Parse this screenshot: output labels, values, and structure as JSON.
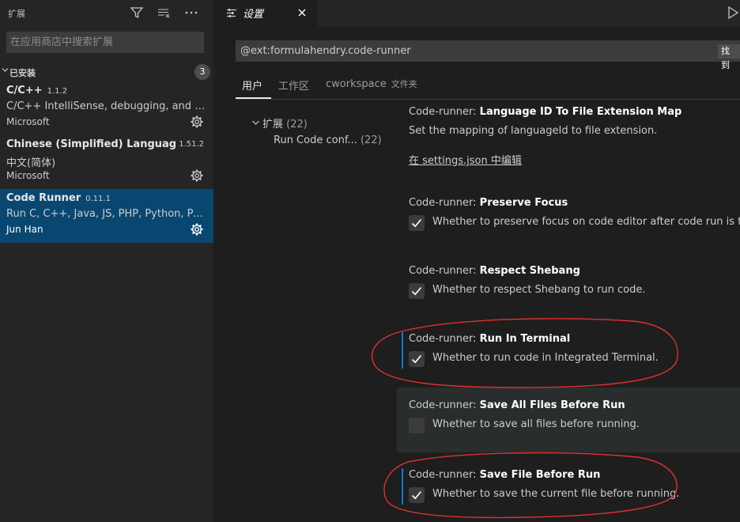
{
  "sidebar": {
    "title": "扩展",
    "search_placeholder": "在应用商店中搜索扩展",
    "section_label": "已安装",
    "installed_count": "3",
    "extensions": [
      {
        "name": "C/C++",
        "version": "1.1.2",
        "description": "C/C++ IntelliSense, debugging, and c...",
        "publisher": "Microsoft",
        "selected": false
      },
      {
        "name": "Chinese (Simplified) Languag...",
        "version": "1.51.2",
        "description": "中文(简体)",
        "publisher": "Microsoft",
        "selected": false
      },
      {
        "name": "Code Runner",
        "version": "0.11.1",
        "description": "Run C, C++, Java, JS, PHP, Python, Perl...",
        "publisher": "Jun Han",
        "selected": true
      }
    ]
  },
  "editor": {
    "tab_label": "设置"
  },
  "settings": {
    "search_value": "@ext:formulahendry.code-runner",
    "search_result_label": "找到",
    "scopes": [
      {
        "label": "用户",
        "active": true
      },
      {
        "label": "工作区",
        "active": false
      },
      {
        "label": "cworkspace",
        "sub": "文件夹",
        "active": false
      }
    ],
    "toc": [
      {
        "label": "扩展",
        "count": "(22)",
        "expanded": true
      },
      {
        "label": "Run Code conf...",
        "count": "(22)"
      }
    ],
    "items": [
      {
        "category": "Code-runner: ",
        "name": "Language ID To File Extension Map",
        "description": "Set the mapping of languageId to file extension.",
        "link": "在 settings.json 中编辑"
      },
      {
        "category": "Code-runner: ",
        "name": "Preserve Focus",
        "description": "Whether to preserve focus on code editor after code run is triggered.",
        "checked": true
      },
      {
        "category": "Code-runner: ",
        "name": "Respect Shebang",
        "description": "Whether to respect Shebang to run code.",
        "checked": true
      },
      {
        "category": "Code-runner: ",
        "name": "Run In Terminal",
        "description": "Whether to run code in Integrated Terminal.",
        "checked": true,
        "focused": true
      },
      {
        "category": "Code-runner: ",
        "name": "Save All Files Before Run",
        "description": "Whether to save all files before running.",
        "checked": false,
        "hover": true
      },
      {
        "category": "Code-runner: ",
        "name": "Save File Before Run",
        "description": "Whether to save the current file before running.",
        "checked": true,
        "focused": true
      }
    ]
  },
  "colors": {
    "accent": "#007fd4",
    "selection": "#094771",
    "annotation": "#e03030"
  },
  "icons": [
    "filter-icon",
    "clear-extensions-icon",
    "more-actions-icon",
    "chevron-down-icon",
    "gear-icon",
    "settings-tab-icon",
    "close-icon",
    "run-icon",
    "check-icon"
  ]
}
